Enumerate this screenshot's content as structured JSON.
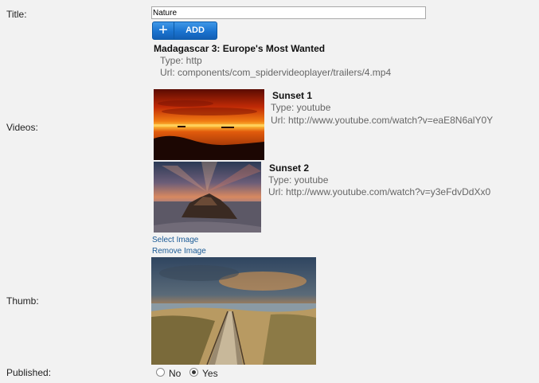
{
  "labels": {
    "title": "Title:",
    "videos": "Videos:",
    "thumb": "Thumb:",
    "published": "Published:"
  },
  "title_value": "Nature",
  "add_button": {
    "icon": "+",
    "label": "ADD"
  },
  "videos": [
    {
      "title": "Madagascar 3: Europe's Most Wanted",
      "type": "Type: http",
      "url": "Url: components/com_spidervideoplayer/trailers/4.mp4"
    },
    {
      "title": "Sunset 1",
      "type": "Type: youtube",
      "url": "Url: http://www.youtube.com/watch?v=eaE8N6alY0Y"
    },
    {
      "title": "Sunset 2",
      "type": "Type: youtube",
      "url": "Url: http://www.youtube.com/watch?v=y3eFdvDdXx0"
    }
  ],
  "thumb_links": {
    "select": "Select Image",
    "remove": "Remove Image"
  },
  "published": {
    "no": "No",
    "yes": "Yes",
    "selected": "Yes"
  }
}
